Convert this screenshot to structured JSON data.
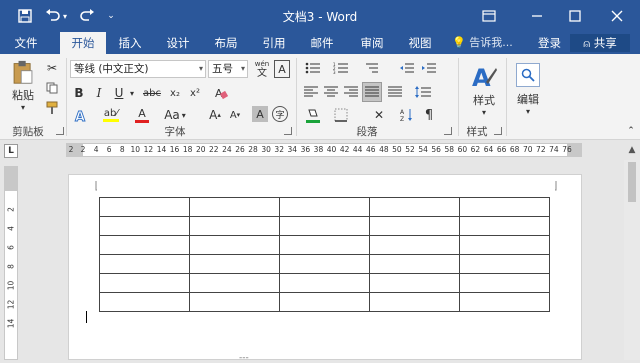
{
  "app": {
    "doc_title": "文档3 - Word"
  },
  "tabs": [
    "文件",
    "开始",
    "插入",
    "设计",
    "布局",
    "引用",
    "邮件",
    "审阅",
    "视图"
  ],
  "tell_me": "告诉我...",
  "login": "登录",
  "share": "共享",
  "ribbon": {
    "clipboard": {
      "paste": "粘贴",
      "label": "剪贴板"
    },
    "font": {
      "font_name": "等线 (中文正文)",
      "font_size": "五号",
      "label": "字体",
      "wen_small": "wén",
      "wen_big": "文",
      "aa": "Aa",
      "clear_a": "A",
      "char_a": "A",
      "circle_char": "字",
      "grow": "A",
      "shrink": "A",
      "bold": "B",
      "italic": "I",
      "underline": "U",
      "strike": "abc",
      "sub": "x₂",
      "sup": "x²"
    },
    "paragraph": {
      "label": "段落"
    },
    "styles": {
      "btn": "样式",
      "label": "样式"
    },
    "editing": {
      "btn": "编辑"
    }
  },
  "ruler": {
    "corner": "L",
    "ticks": [
      "2",
      "2",
      "4",
      "6",
      "8",
      "10",
      "12",
      "14",
      "16",
      "18",
      "20",
      "22",
      "24",
      "26",
      "28",
      "30",
      "32",
      "34",
      "36",
      "38",
      "40",
      "42",
      "44",
      "46",
      "48",
      "50",
      "52",
      "54",
      "56",
      "58",
      "60",
      "62",
      "64",
      "66",
      "68",
      "70",
      "72",
      "74",
      "76"
    ]
  },
  "vruler": {
    "ticks": [
      "2",
      "4",
      "6",
      "8",
      "10",
      "12",
      "14"
    ]
  },
  "table": {
    "rows": 6,
    "cols": 5
  },
  "stray_text": "---"
}
